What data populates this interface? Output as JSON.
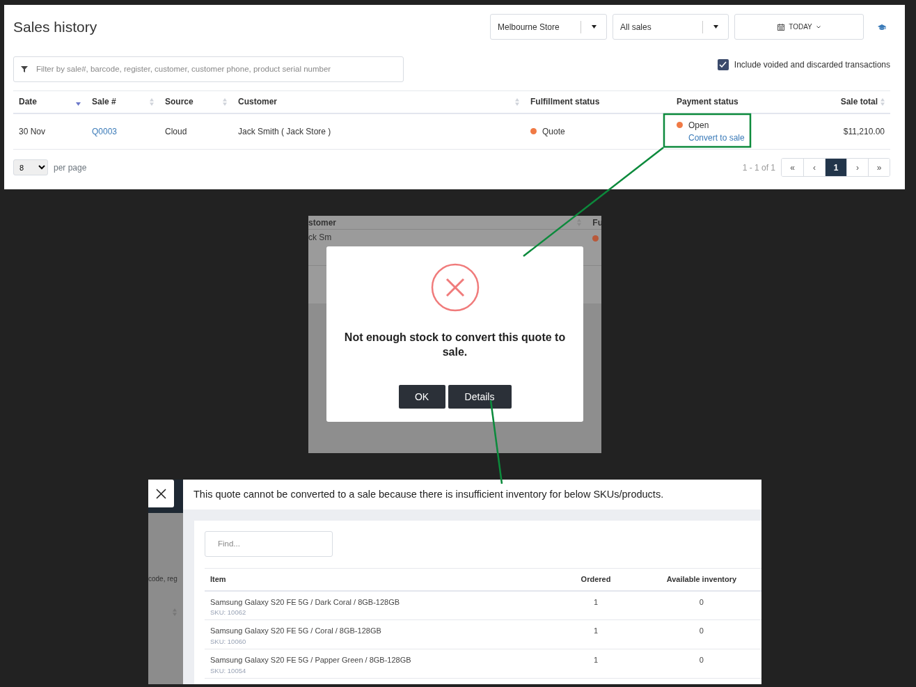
{
  "sales_history": {
    "title": "Sales history",
    "store_select": {
      "value": "Melbourne Store"
    },
    "type_select": {
      "value": "All sales"
    },
    "date_button": {
      "label": "TODAY"
    },
    "filter": {
      "placeholder": "Filter by sale#, barcode, register, customer, customer phone, product serial number"
    },
    "include_voided": {
      "label": "Include voided and discarded transactions",
      "checked": true
    },
    "table": {
      "columns": [
        {
          "label": "Date",
          "sortable": true,
          "sorted": true
        },
        {
          "label": "Sale #",
          "sortable": true,
          "sorted": false
        },
        {
          "label": "Source",
          "sortable": true,
          "sorted": false
        },
        {
          "label": "Customer",
          "sortable": true,
          "sorted": false
        },
        {
          "label": "Fulfillment status",
          "sortable": false,
          "sorted": false
        },
        {
          "label": "Payment status",
          "sortable": false,
          "sorted": false
        },
        {
          "label": "Sale total",
          "sortable": true,
          "sorted": false
        }
      ],
      "rows": [
        {
          "date": "30 Nov",
          "sale_number": "Q0003",
          "source": "Cloud",
          "customer": "Jack Smith ( Jack Store )",
          "fulfillment_status": {
            "label": "Quote",
            "color": "#f07a45"
          },
          "payment_status": {
            "label": "Open",
            "color": "#f07a45",
            "action": "Convert to sale",
            "highlighted": true
          },
          "total": "$11,210.00"
        }
      ]
    },
    "per_page": {
      "value": "8",
      "label": "per page"
    },
    "pagination": {
      "summary": "1 - 1 of 1",
      "first": "«",
      "prev": "‹",
      "pages": [
        {
          "label": "1",
          "selected": true
        }
      ],
      "next": "›",
      "last": "»"
    }
  },
  "dialog_snapshot": {
    "background_texts": [
      {
        "kind": "header",
        "text": "stomer"
      },
      {
        "kind": "header-right",
        "text": "Fu"
      },
      {
        "kind": "row",
        "text": "ck Sm"
      }
    ],
    "message": "Not enough stock to convert this quote to sale.",
    "buttons": [
      {
        "label": "OK"
      },
      {
        "label": "Details"
      }
    ]
  },
  "details_snapshot": {
    "background_text": "code, reg",
    "message": "This quote cannot be converted to a sale because there is insufficient inventory for below SKUs/products.",
    "search": {
      "placeholder": "Find..."
    },
    "columns": [
      "Item",
      "Ordered",
      "Available inventory"
    ],
    "rows": [
      {
        "item": "Samsung Galaxy S20 FE 5G / Dark Coral / 8GB-128GB",
        "sku": "SKU: 10062",
        "ordered": "1",
        "available": "0"
      },
      {
        "item": "Samsung Galaxy S20 FE 5G / Coral / 8GB-128GB",
        "sku": "SKU: 10060",
        "ordered": "1",
        "available": "0"
      },
      {
        "item": "Samsung Galaxy S20 FE 5G / Papper Green / 8GB-128GB",
        "sku": "SKU: 10054",
        "ordered": "1",
        "available": "0"
      }
    ]
  }
}
